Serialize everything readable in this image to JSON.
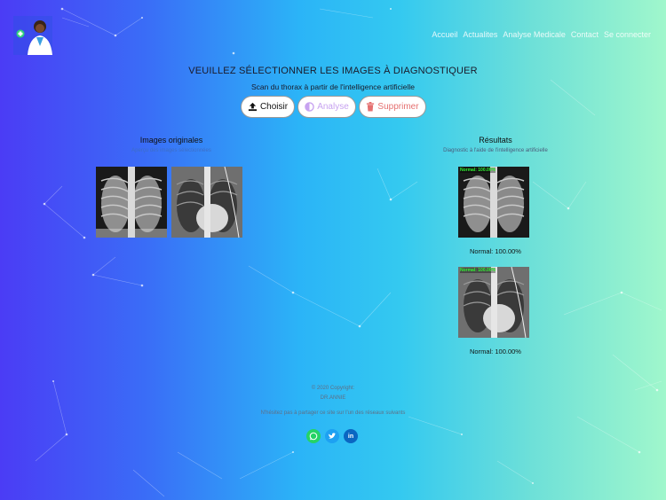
{
  "header": {
    "nav": [
      "Accueil",
      "Actualites",
      "Analyse Medicale",
      "Contact",
      "Se connecter"
    ]
  },
  "main": {
    "title": "VEUILLEZ SÉLECTIONNER LES IMAGES À DIAGNOSTIQUER",
    "subtitle": "Scan du thorax à partir de l'intelligence artificielle",
    "buttons": {
      "choose": "Choisir",
      "analyse": "Analyse",
      "delete": "Supprimer"
    }
  },
  "originals": {
    "heading": "Images originales",
    "sub": "Aperçu des images sélectionnées"
  },
  "results": {
    "heading": "Résultats",
    "sub": "Diagnostic à l'aide de l'intelligence artificielle",
    "items": [
      {
        "tag": "Normal: 100.00%",
        "label": "Normal: 100.00%"
      },
      {
        "tag": "Normal: 100.00%",
        "label": "Normal: 100.00%"
      }
    ]
  },
  "footer": {
    "copyright": "© 2020 Copyright:",
    "author": "DR.ANNIE",
    "share": "N'hésitez pas à partager ce site sur l'un des réseaux suivants",
    "social": [
      "whatsapp-icon",
      "twitter-icon",
      "linkedin-icon"
    ]
  },
  "colors": {
    "whatsapp": "#25d366",
    "twitter": "#1da1f2",
    "linkedin": "#0a66c2",
    "analyse": "#c7a3f0",
    "delete": "#e57070"
  }
}
